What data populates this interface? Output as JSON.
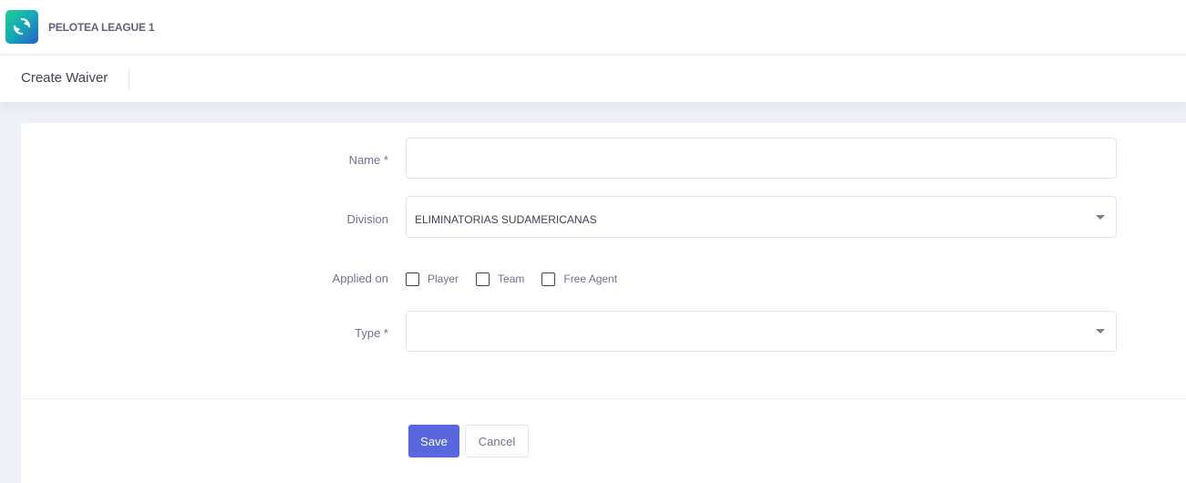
{
  "app": {
    "brand_name": "PELOTEA LEAGUE 1",
    "logo_icon": "ring-arrows-icon",
    "accent_color": "#5867dd"
  },
  "header": {
    "page_title": "Create Waiver"
  },
  "form": {
    "name": {
      "label": "Name *",
      "value": ""
    },
    "division": {
      "label": "Division",
      "selected": "ELIMINATORIAS SUDAMERICANAS"
    },
    "applied_on": {
      "label": "Applied on",
      "options": [
        {
          "label": "Player",
          "checked": false
        },
        {
          "label": "Team",
          "checked": false
        },
        {
          "label": "Free Agent",
          "checked": false
        }
      ]
    },
    "type": {
      "label": "Type *",
      "selected": ""
    }
  },
  "actions": {
    "save_label": "Save",
    "cancel_label": "Cancel"
  }
}
